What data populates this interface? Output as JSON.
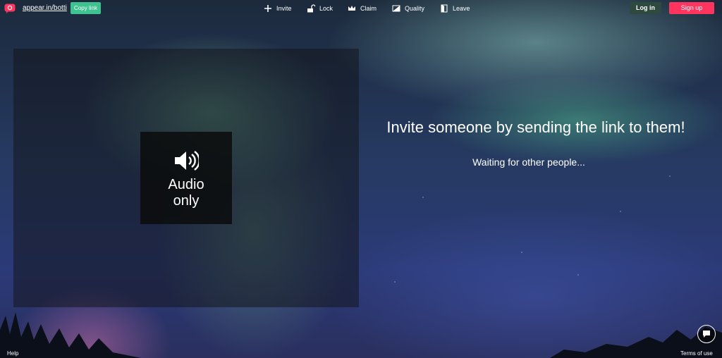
{
  "topbar": {
    "room_link": "appear.in/botti",
    "copy_label": "Copy link",
    "nav": [
      {
        "icon": "plus-icon",
        "label": "Invite"
      },
      {
        "icon": "lock-icon",
        "label": "Lock"
      },
      {
        "icon": "crown-icon",
        "label": "Claim"
      },
      {
        "icon": "quality-icon",
        "label": "Quality"
      },
      {
        "icon": "door-icon",
        "label": "Leave"
      }
    ],
    "login_label": "Log in",
    "signup_label": "Sign up"
  },
  "video": {
    "audio_line1": "Audio",
    "audio_line2": "only"
  },
  "main": {
    "invite_title": "Invite someone by sending the link to them!",
    "waiting_text": "Waiting for other people..."
  },
  "footer": {
    "help_label": "Help",
    "terms_label": "Terms of use"
  },
  "colors": {
    "copy_button": "#3ec28f",
    "signup_button": "#ff3560",
    "login_button": "#2e4a40"
  }
}
